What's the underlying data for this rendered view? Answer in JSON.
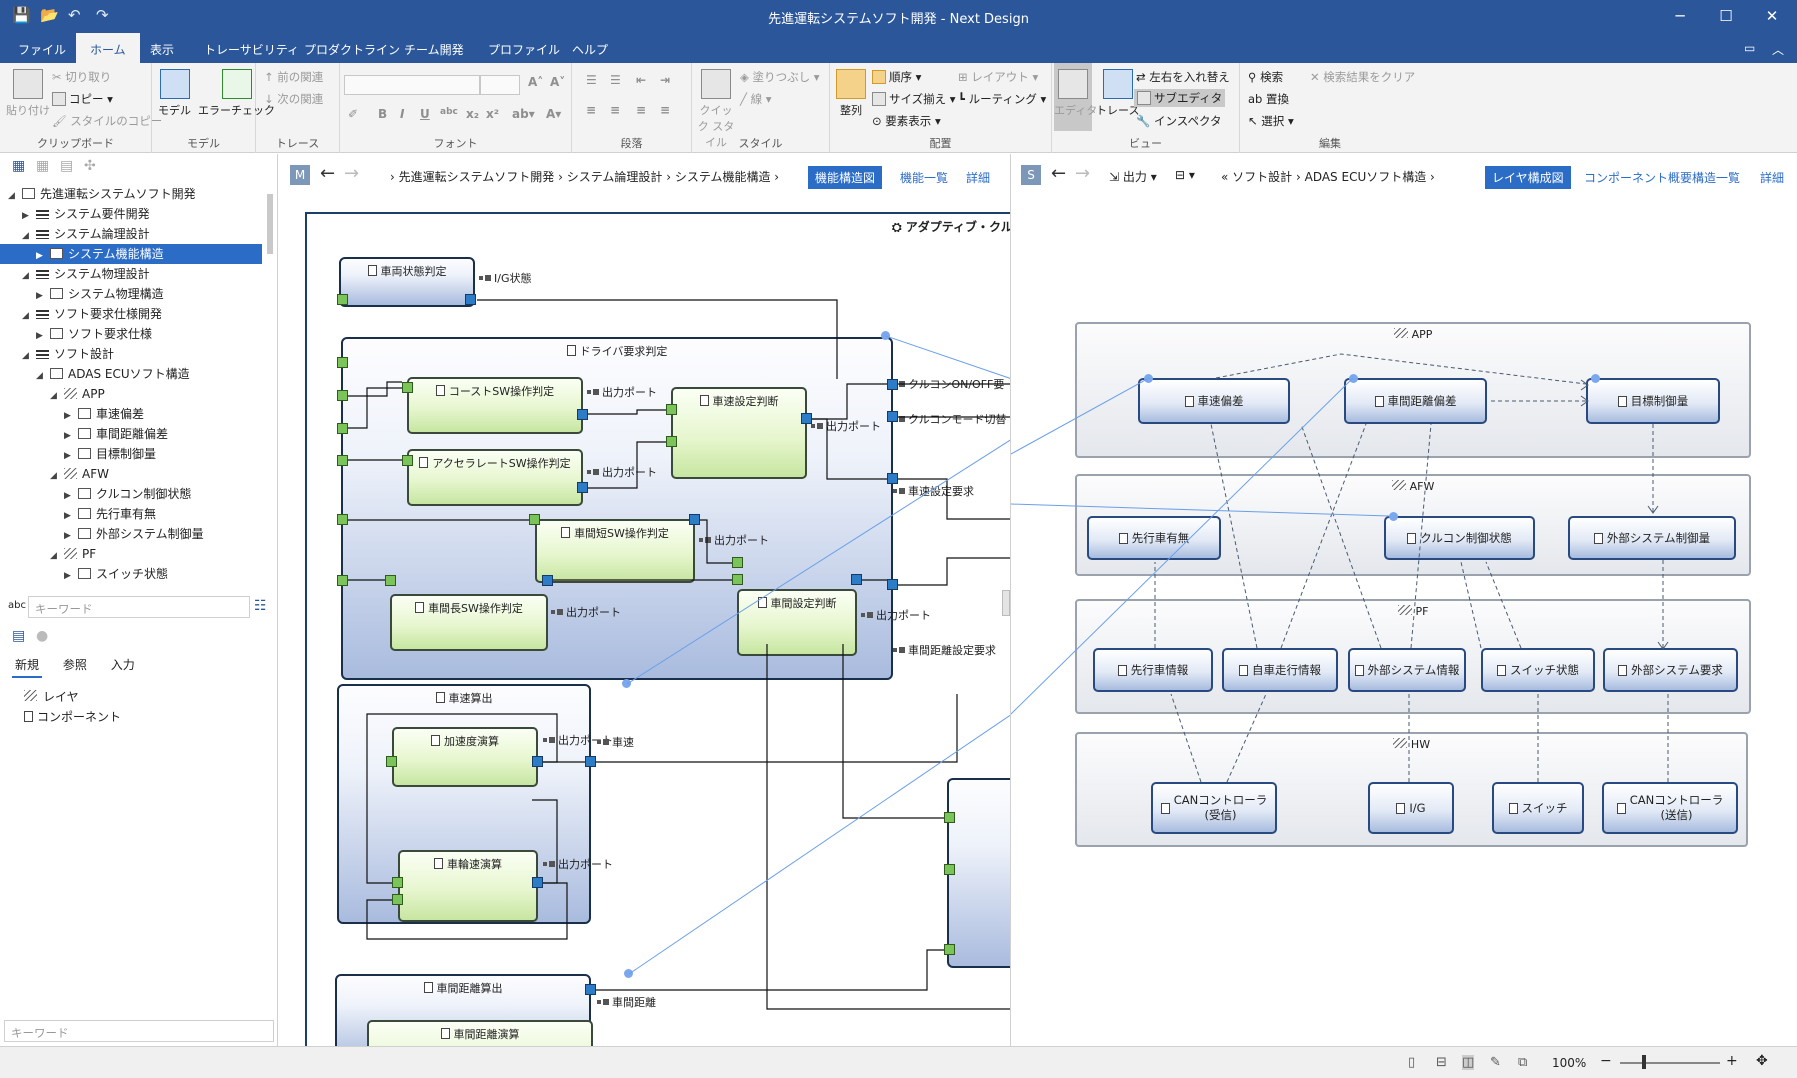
{
  "window": {
    "title": "先進運転システムソフト開発 - Next Design",
    "min": "─",
    "max": "☐",
    "close": "✕"
  },
  "menu": [
    {
      "label": "ファイル",
      "active": false
    },
    {
      "label": "ホーム",
      "active": true
    },
    {
      "label": "表示",
      "active": false
    },
    {
      "label": "トレーサビリティ",
      "active": false
    },
    {
      "label": "プロダクトライン",
      "active": false
    },
    {
      "label": "チーム開発",
      "active": false
    },
    {
      "label": "プロファイル",
      "active": false
    },
    {
      "label": "ヘルプ",
      "active": false
    }
  ],
  "ribbon": {
    "clipboard": {
      "label": "クリップボード",
      "paste": "貼り付け",
      "cut": "切り取り",
      "copy": "コピー",
      "style_copy": "スタイルのコピー"
    },
    "model": {
      "label": "モデル",
      "model": "モデル",
      "error_check": "エラーチェック"
    },
    "trace": {
      "label": "トレース",
      "prev": "前の関連",
      "next": "次の関連"
    },
    "font": {
      "label": "フォント"
    },
    "paragraph": {
      "label": "段落"
    },
    "style": {
      "label": "スタイル",
      "quick": "クイック スタイル",
      "fill": "塗りつぶし",
      "line": "線"
    },
    "layout": {
      "label": "配置",
      "align": "整列",
      "order": "順序",
      "size": "サイズ揃え",
      "display": "要素表示",
      "layout": "レイアウト",
      "routing": "ルーティング"
    },
    "view": {
      "label": "ビュー",
      "editor": "エディタ",
      "trace": "トレース",
      "swap": "左右を入れ替え",
      "sub_editor": "サブエディタ",
      "inspector": "インスペクタ"
    },
    "edit": {
      "label": "編集",
      "search": "検索",
      "replace": "置換",
      "select": "選択",
      "clear": "検索結果をクリア"
    }
  },
  "tree": [
    {
      "label": "先進運転システムソフト開発",
      "indent": 0,
      "arrow": "◢",
      "icon": "project-icon",
      "sel": false
    },
    {
      "label": "システム要件開発",
      "indent": 1,
      "arrow": "▶",
      "icon": "pkg",
      "sel": false
    },
    {
      "label": "システム論理設計",
      "indent": 1,
      "arrow": "◢",
      "icon": "pkg",
      "sel": false
    },
    {
      "label": "システム機能構造",
      "indent": 2,
      "arrow": "▶",
      "icon": "model",
      "sel": true
    },
    {
      "label": "システム物理設計",
      "indent": 1,
      "arrow": "◢",
      "icon": "pkg",
      "sel": false
    },
    {
      "label": "システム物理構造",
      "indent": 2,
      "arrow": "▶",
      "icon": "model",
      "sel": false
    },
    {
      "label": "ソフト要求仕様開発",
      "indent": 1,
      "arrow": "◢",
      "icon": "pkg",
      "sel": false
    },
    {
      "label": "ソフト要求仕様",
      "indent": 2,
      "arrow": "▶",
      "icon": "model",
      "sel": false
    },
    {
      "label": "ソフト設計",
      "indent": 1,
      "arrow": "◢",
      "icon": "pkg",
      "sel": false
    },
    {
      "label": "ADAS ECUソフト構造",
      "indent": 2,
      "arrow": "◢",
      "icon": "model",
      "sel": false
    },
    {
      "label": "APP",
      "indent": 3,
      "arrow": "◢",
      "icon": "lay",
      "sel": false
    },
    {
      "label": "車速偏差",
      "indent": 4,
      "arrow": "▶",
      "icon": "comp",
      "sel": false
    },
    {
      "label": "車間距離偏差",
      "indent": 4,
      "arrow": "▶",
      "icon": "comp",
      "sel": false
    },
    {
      "label": "目標制御量",
      "indent": 4,
      "arrow": "▶",
      "icon": "comp",
      "sel": false
    },
    {
      "label": "AFW",
      "indent": 3,
      "arrow": "◢",
      "icon": "lay",
      "sel": false
    },
    {
      "label": "クルコン制御状態",
      "indent": 4,
      "arrow": "▶",
      "icon": "comp",
      "sel": false
    },
    {
      "label": "先行車有無",
      "indent": 4,
      "arrow": "▶",
      "icon": "comp",
      "sel": false
    },
    {
      "label": "外部システム制御量",
      "indent": 4,
      "arrow": "▶",
      "icon": "comp",
      "sel": false
    },
    {
      "label": "PF",
      "indent": 3,
      "arrow": "◢",
      "icon": "lay",
      "sel": false
    },
    {
      "label": "スイッチ状態",
      "indent": 4,
      "arrow": "▶",
      "icon": "comp",
      "sel": false
    }
  ],
  "left": {
    "keyword_placeholder": "キーワード",
    "tabs": [
      "新規",
      "参照",
      "入力"
    ],
    "palette": [
      "レイヤ",
      "コンポーネント"
    ],
    "keyword2_placeholder": "キーワード"
  },
  "left_nav": {
    "icon": "M",
    "breadcrumb": [
      "先進運転システムソフト開発",
      "システム論理設計",
      "システム機能構造"
    ],
    "views": [
      "機能構造図",
      "機能一覧",
      "詳細"
    ],
    "diagram_title": "アダプティブ・クル"
  },
  "right_nav": {
    "icon": "S",
    "output": "出力",
    "breadcrumb": [
      "ソフト設計",
      "ADAS ECUソフト構造"
    ],
    "views": [
      "レイヤ構成図",
      "コンポーネント概要",
      "構造一覧",
      "詳細"
    ]
  },
  "func": {
    "vehicle_state": "車両状態判定",
    "ig": "I/G状態",
    "driver": "ドライバ要求判定",
    "coast": "コーストSW操作判定",
    "accel": "アクセラレートSW操作判定",
    "speed_set": "車速設定判断",
    "short": "車間短SW操作判定",
    "long": "車間長SW操作判定",
    "gap_set": "車間設定判断",
    "outport": "出力ポート",
    "cc_onoff": "クルコンON/OFF要",
    "cc_mode": "クルコンモード切替",
    "speed_req": "車速設定要求",
    "gap_req": "車間距離設定要求",
    "speed_calc": "車速算出",
    "accel_calc": "加速度演算",
    "wheel_calc": "車輪速演算",
    "speed": "車速",
    "gap_calc": "車間距離算出",
    "gap_comp": "車間距離演算",
    "gap": "車間距離"
  },
  "layers": {
    "app": "APP",
    "afw": "AFW",
    "pf": "PF",
    "hw": "HW",
    "app_items": [
      "車速偏差",
      "車間距離偏差",
      "目標制御量"
    ],
    "afw_items": [
      "先行車有無",
      "クルコン制御状態",
      "外部システム制御量"
    ],
    "pf_items": [
      "先行車情報",
      "自車走行情報",
      "外部システム情報",
      "スイッチ状態",
      "外部システム要求"
    ],
    "hw_items": [
      "CANコントローラ\n(受信)",
      "I/G",
      "スイッチ",
      "CANコントローラ\n(送信)"
    ]
  },
  "status": {
    "zoom": "100%"
  }
}
